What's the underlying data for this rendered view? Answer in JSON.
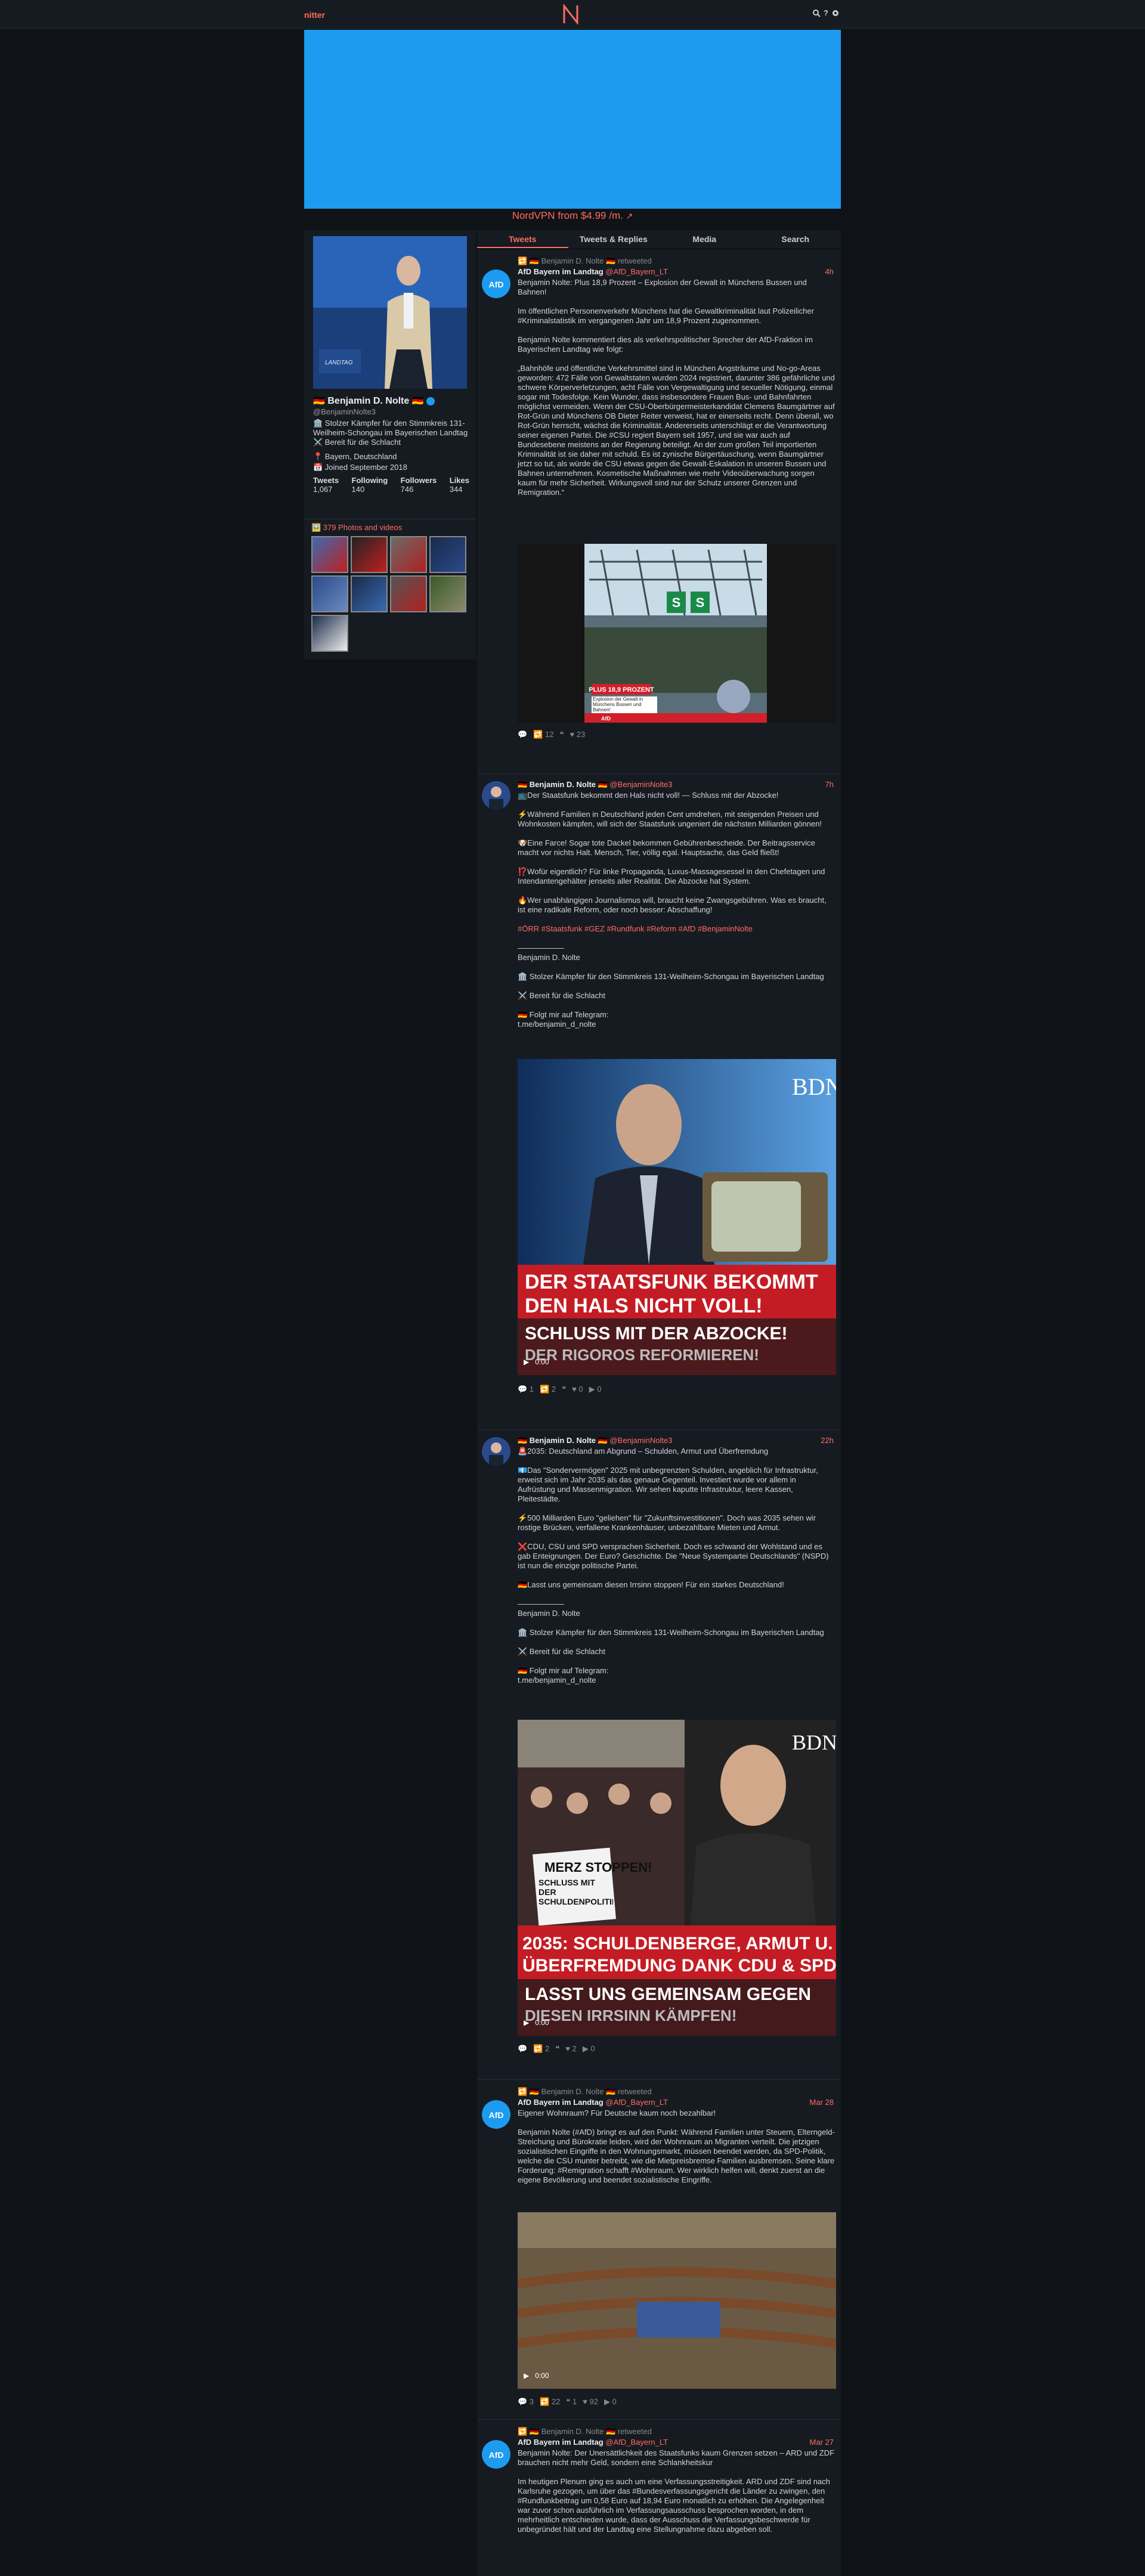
{
  "nav": {
    "logo": "nitter",
    "icons": [
      "search-icon",
      "info-icon",
      "gear-icon"
    ]
  },
  "ad": {
    "text": "NordVPN from $4.99 /m.",
    "icon": "external-link-icon"
  },
  "profile": {
    "name": "🇩🇪 Benjamin D. Nolte 🇩🇪",
    "handle": "@BenjaminNolte3",
    "bio": "🏛️ Stolzer Kämpfer für den Stimmkreis 131-Weilheim-Schongau im Bayerischen Landtag ⚔️ Bereit für die Schlacht",
    "location": "📍 Bayern, Deutschland",
    "joined": "📅 Joined September 2018",
    "stats": [
      {
        "label": "Tweets",
        "value": "1,067"
      },
      {
        "label": "Following",
        "value": "140"
      },
      {
        "label": "Followers",
        "value": "746"
      },
      {
        "label": "Likes",
        "value": "344"
      }
    ]
  },
  "media": {
    "title": "🖼️ 379 Photos and videos"
  },
  "tabs": [
    "Tweets",
    "Tweets & Replies",
    "Media",
    "Search"
  ],
  "tweets": [
    {
      "retweet": "🔁 🇩🇪 Benjamin D. Nolte 🇩🇪 retweeted",
      "name": "AfD Bayern im Landtag",
      "handle": "@AfD_Bayern_LT",
      "date": "4h",
      "paragraphs": [
        "Benjamin Nolte: Plus 18,9 Prozent – Explosion der Gewalt in Münchens Bussen und Bahnen!",
        "Im öffentlichen Personenverkehr Münchens hat die Gewaltkriminalität laut Polizeilicher #Kriminalstatistik im vergangenen Jahr um 18,9 Prozent zugenommen.",
        "Benjamin Nolte kommentiert dies als verkehrspolitischer Sprecher der AfD-Fraktion im Bayerischen Landtag wie folgt:",
        "„Bahnhöfe und öffentliche Verkehrsmittel sind in München Angsträume und No-go-Areas geworden: 472 Fälle von Gewaltstaten wurden 2024 registriert, darunter 386 gefährliche und schwere Körperverletzungen, acht Fälle von Vergewaltigung und sexueller Nötigung, einmal sogar mit Todesfolge. Kein Wunder, dass insbesondere Frauen Bus- und Bahnfahrten möglichst vermeiden. Wenn der CSU-Oberbürgermeisterkandidat Clemens Baumgärtner auf Rot-Grün und Münchens OB Dieter Reiter verweist, hat er einerseits recht. Denn überall, wo Rot-Grün herrscht, wächst die Kriminalität. Andererseits unterschlägt er die Verantwortung seiner eigenen Partei. Die #CSU regiert Bayern seit 1957, und sie war auch auf Bundesebene meistens an der Regierung beteiligt. An der zum großen Teil importierten Kriminalität ist sie daher mit schuld. Es ist zynische Bürgertäuschung, wenn Baumgärtner jetzt so tut, als würde die CSU etwas gegen die Gewalt-Eskalation in unseren Bussen und Bahnen unternehmen. Kosmetische Maßnahmen wie mehr Videoüberwachung sorgen kaum für mehr Sicherheit. Wirkungsvoll sind nur der Schutz unserer Grenzen und Remigration.“"
      ],
      "image_text": {
        "badge": "PLUS 18,9 PROZENT",
        "caption": "Explosion der Gewalt in Münchens Bussen und Bahnen!",
        "brand": "AfD"
      },
      "stats": [
        "💬",
        "🔁 12",
        "❝",
        "♥ 23"
      ]
    },
    {
      "retweet": "",
      "name": "🇩🇪 Benjamin D. Nolte 🇩🇪",
      "handle": "@BenjaminNolte3",
      "date": "7h",
      "paragraphs": [
        "📺Der Staatsfunk bekommt den Hals nicht voll! — Schluss mit der Abzocke!",
        "⚡Während Familien in Deutschland jeden Cent umdrehen, mit steigenden Preisen und Wohnkosten kämpfen, will sich der Staatsfunk ungeniert die nächsten Milliarden gönnen!",
        "🐶Eine Farce! Sogar tote Dackel bekommen Gebührenbescheide. Der Beitragsservice macht vor nichts Halt. Mensch, Tier, völlig egal. Hauptsache, das Geld fließt!",
        "⁉️Wofür eigentlich? Für linke Propaganda, Luxus-Massagesessel in den Chefetagen und Intendantengehälter jenseits aller Realität. Die Abzocke hat System.",
        "🔥Wer unabhängigen Journalismus will, braucht keine Zwangsgebühren. Was es braucht, ist eine radikale Reform, oder noch besser: Abschaffung!",
        "#ÖRR #Staatsfunk #GEZ #Rundfunk #Reform #AfD #BenjaminNolte",
        "——————\nBenjamin D. Nolte",
        "🏛️ Stolzer Kämpfer für den Stimmkreis 131-Weilheim-Schongau im Bayerischen Landtag",
        "⚔️ Bereit für die Schlacht",
        "🇩🇪 Folgt mir auf Telegram:\nt.me/benjamin_d_nolte"
      ],
      "video_text": {
        "line1": "DER STAATSFUNK BEKOMMT",
        "line2": "DEN HALS NICHT VOLL!",
        "line3": "SCHLUSS MIT DER ABZOCKE!",
        "line4": "DER RIGOROS REFORMIEREN!",
        "time": "0:00",
        "brand": "BDN"
      },
      "stats": [
        "💬 1",
        "🔁 2",
        "❝",
        "♥ 0",
        "▶ 0"
      ]
    },
    {
      "retweet": "",
      "name": "🇩🇪 Benjamin D. Nolte 🇩🇪",
      "handle": "@BenjaminNolte3",
      "date": "22h",
      "paragraphs": [
        "🚨2035: Deutschland am Abgrund – Schulden, Armut und Überfremdung",
        "💶Das \"Sondervermögen\" 2025 mit unbegrenzten Schulden, angeblich für Infrastruktur, erweist sich im Jahr 2035 als das genaue Gegenteil. Investiert wurde vor allem in Aufrüstung und Massenmigration. Wir sehen kaputte Infrastruktur, leere Kassen, Pleitestädte.",
        "⚡500 Milliarden Euro \"geliehen\" für \"Zukunftsinvestitionen\". Doch was 2035 sehen wir rostige Brücken, verfallene Krankenhäuser, unbezahlbare Mieten und Armut.",
        "❌CDU, CSU und SPD versprachen Sicherheit. Doch es schwand der Wohlstand und es gab Enteignungen. Der Euro? Geschichte. Die \"Neue Systempartei Deutschlands\" (NSPD) ist nun die einzige politische Partei.",
        "🇩🇪Lasst uns gemeinsam diesen Irrsinn stoppen! Für ein starkes Deutschland!",
        "——————\nBenjamin D. Nolte",
        "🏛️ Stolzer Kämpfer für den Stimmkreis 131-Weilheim-Schongau im Bayerischen Landtag",
        "⚔️ Bereit für die Schlacht",
        "🇩🇪 Folgt mir auf Telegram:\nt.me/benjamin_d_nolte"
      ],
      "video_text": {
        "sign1": "MERZ STOPPEN!",
        "sign2": "SCHLUSS MIT DER SCHULDENPOLITIK",
        "line1": "2035: SCHULDENBERGE, ARMUT U.",
        "line2": "ÜBERFREMDUNG DANK CDU & SPD!",
        "line3": "LASST UNS GEMEINSAM GEGEN",
        "line4": "DIESEN IRRSINN KÄMPFEN!",
        "time": "0:00",
        "brand": "BDN"
      },
      "stats": [
        "💬",
        "🔁 2",
        "❝",
        "♥ 2",
        "▶ 0"
      ]
    },
    {
      "retweet": "🔁 🇩🇪 Benjamin D. Nolte 🇩🇪 retweeted",
      "name": "AfD Bayern im Landtag",
      "handle": "@AfD_Bayern_LT",
      "date": "Mar 28",
      "paragraphs": [
        "Eigener Wohnraum? Für Deutsche kaum noch bezahlbar!",
        "Benjamin Nolte (#AfD) bringt es auf den Punkt: Während Familien unter Steuern, Elterngeld-Streichung und Bürokratie leiden, wird der Wohnraum an Migranten verteilt. Die jetzigen sozialistischen Eingriffe in den Wohnungsmarkt, müssen beendet werden, da SPD-Politik, welche die CSU munter betreibt, wie die Mietpreisbremse Familien ausbremsen. Seine klare Forderung: #Remigration schafft #Wohnraum. Wer wirklich helfen will, denkt zuerst an die eigene Bevölkerung und beendet sozialistische Eingriffe."
      ],
      "video_text": {
        "time": "0:00"
      },
      "stats": [
        "💬 3",
        "🔁 22",
        "❝ 1",
        "♥ 92",
        "▶ 0"
      ]
    },
    {
      "retweet": "🔁 🇩🇪 Benjamin D. Nolte 🇩🇪 retweeted",
      "name": "AfD Bayern im Landtag",
      "handle": "@AfD_Bayern_LT",
      "date": "Mar 27",
      "paragraphs": [
        "Benjamin Nolte: Der Unersättlichkeit des Staatsfunks kaum Grenzen setzen – ARD und ZDF brauchen nicht mehr Geld, sondern eine Schlankheitskur",
        "Im heutigen Plenum ging es auch um eine Verfassungsstreitigkeit. ARD und ZDF sind nach Karlsruhe gezogen, um über das #Bundesverfassungsgericht die Länder zu zwingen, den #Rundfunkbeitrag um 0,58 Euro auf 18,94 Euro monatlich zu erhöhen. Die Angelegenheit war zuvor schon ausführlich im Verfassungsausschuss besprochen worden, in dem mehrheitlich entschieden wurde, dass der Ausschuss die Verfassungsbeschwerde für unbegründet hält und der Landtag eine Stellungnahme dazu abgeben soll."
      ],
      "stats": []
    }
  ]
}
